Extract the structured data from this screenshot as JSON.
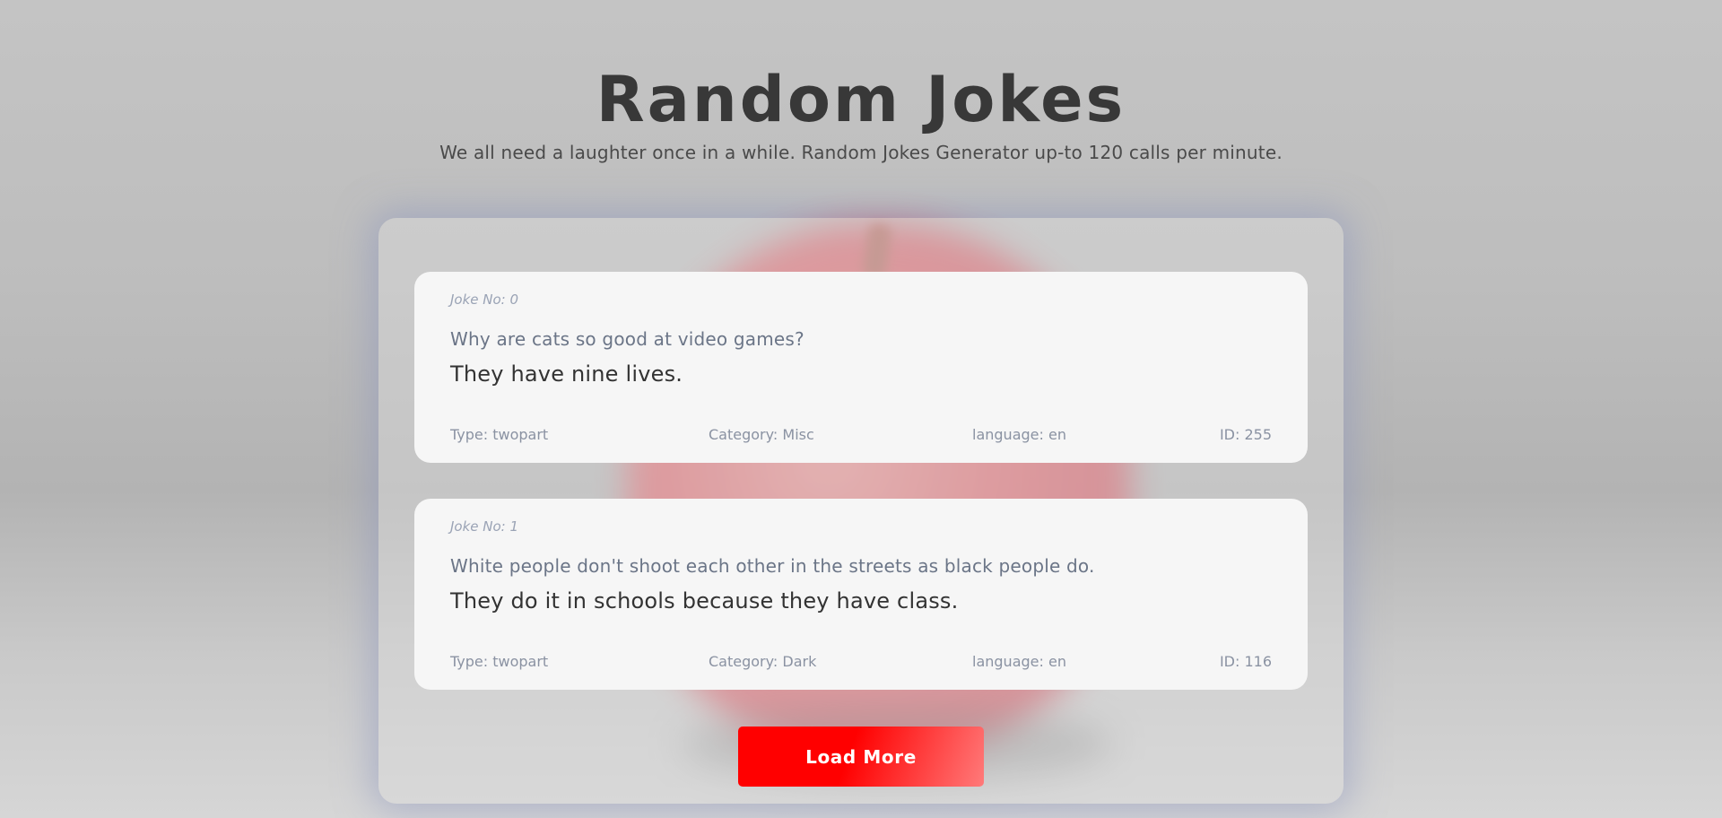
{
  "header": {
    "title": "Random Jokes",
    "subtitle": "We all need a laughter once in a while. Random Jokes Generator up-to 120 calls per minute."
  },
  "jokes": [
    {
      "number": "Joke No: 0",
      "setup": "Why are cats so good at video games?",
      "delivery": "They have nine lives.",
      "type": "Type: twopart",
      "category": "Category: Misc",
      "language": "language: en",
      "id": "ID: 255"
    },
    {
      "number": "Joke No: 1",
      "setup": "White people don't shoot each other in the streets as black people do.",
      "delivery": "They do it in schools because they have class.",
      "type": "Type: twopart",
      "category": "Category: Dark",
      "language": "language: en",
      "id": "ID: 116"
    }
  ],
  "load_more_label": "Load More",
  "colors": {
    "accent": "#ff0000",
    "title": "#383838",
    "card_bg": "#f6f6f6"
  }
}
